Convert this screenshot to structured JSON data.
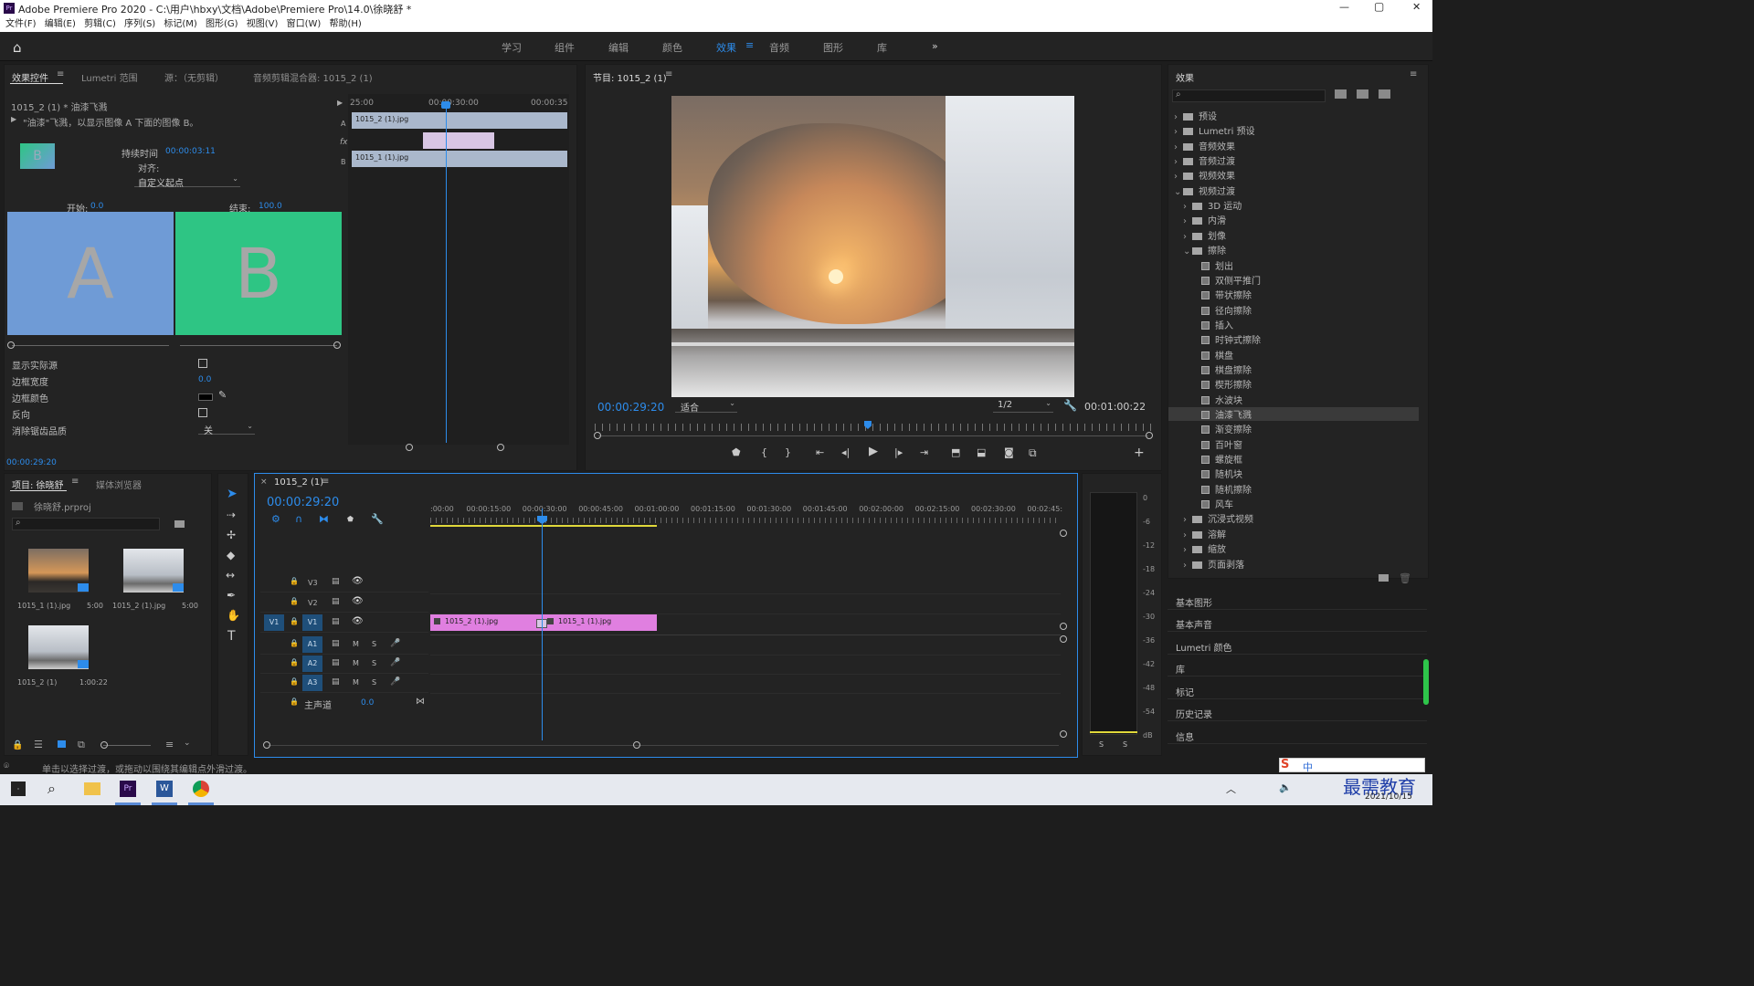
{
  "app": {
    "title": "Adobe Premiere Pro 2020 - C:\\用户\\hbxy\\文档\\Adobe\\Premiere Pro\\14.0\\徐晓舒 *",
    "win_min": "—",
    "win_max": "▢",
    "win_close": "✕"
  },
  "menu": [
    "文件(F)",
    "编辑(E)",
    "剪辑(C)",
    "序列(S)",
    "标记(M)",
    "图形(G)",
    "视图(V)",
    "窗口(W)",
    "帮助(H)"
  ],
  "workspaces": [
    "学习",
    "组件",
    "编辑",
    "颜色",
    "效果",
    "音频",
    "图形",
    "库"
  ],
  "workspace_active": "效果",
  "workspace_more": "»",
  "effect_controls": {
    "tabs": [
      "效果控件",
      "Lumetri 范围",
      "源：（无剪辑）",
      "音频剪辑混合器: 1015_2 (1)"
    ],
    "clip_name": "1015_2 (1) * 油漆飞溅",
    "description": "\"油漆\"飞溅，以显示图像 A 下面的图像 B。",
    "duration_label": "持续时间",
    "duration_value": "00:00:03:11",
    "align_label": "对齐:",
    "align_value": "自定义起点",
    "start_label": "开始:",
    "start_value": "0.0",
    "end_label": "结束:",
    "end_value": "100.0",
    "preview_a": "A",
    "preview_b": "B",
    "thumb_letter": "B",
    "timecodes": [
      "25:00",
      "00:00:30:00",
      "00:00:35"
    ],
    "clip_a": "1015_2 (1).jpg",
    "clip_b": "1015_1 (1).jpg",
    "track_a": "A",
    "track_b": "B",
    "fx": "fx",
    "props": [
      {
        "label": "显示实际源",
        "value": ""
      },
      {
        "label": "边框宽度",
        "value": "0.0"
      },
      {
        "label": "边框颜色",
        "value": ""
      },
      {
        "label": "反向",
        "value": ""
      },
      {
        "label": "消除锯齿品质",
        "value": "关"
      }
    ],
    "current_time": "00:00:29:20"
  },
  "program": {
    "title": "节目: 1015_2 (1)",
    "timecode": "00:00:29:20",
    "fit": "适合",
    "resolution": "1/2",
    "duration": "00:01:00:22",
    "playhead_fraction": 0.49
  },
  "effects_panel": {
    "title": "效果",
    "tree": [
      {
        "label": "预设",
        "level": 0,
        "type": "folder",
        "open": false
      },
      {
        "label": "Lumetri 预设",
        "level": 0,
        "type": "folder",
        "open": false
      },
      {
        "label": "音频效果",
        "level": 0,
        "type": "folder",
        "open": false
      },
      {
        "label": "音频过渡",
        "level": 0,
        "type": "folder",
        "open": false
      },
      {
        "label": "视频效果",
        "level": 0,
        "type": "folder",
        "open": false
      },
      {
        "label": "视频过渡",
        "level": 0,
        "type": "folder",
        "open": true
      },
      {
        "label": "3D 运动",
        "level": 1,
        "type": "folder",
        "open": false
      },
      {
        "label": "内滑",
        "level": 1,
        "type": "folder",
        "open": false
      },
      {
        "label": "划像",
        "level": 1,
        "type": "folder",
        "open": false
      },
      {
        "label": "擦除",
        "level": 1,
        "type": "folder",
        "open": true
      },
      {
        "label": "划出",
        "level": 2,
        "type": "effect"
      },
      {
        "label": "双侧平推门",
        "level": 2,
        "type": "effect"
      },
      {
        "label": "带状擦除",
        "level": 2,
        "type": "effect"
      },
      {
        "label": "径向擦除",
        "level": 2,
        "type": "effect"
      },
      {
        "label": "插入",
        "level": 2,
        "type": "effect"
      },
      {
        "label": "时钟式擦除",
        "level": 2,
        "type": "effect"
      },
      {
        "label": "棋盘",
        "level": 2,
        "type": "effect"
      },
      {
        "label": "棋盘擦除",
        "level": 2,
        "type": "effect"
      },
      {
        "label": "楔形擦除",
        "level": 2,
        "type": "effect"
      },
      {
        "label": "水波块",
        "level": 2,
        "type": "effect"
      },
      {
        "label": "油漆飞溅",
        "level": 2,
        "type": "effect",
        "selected": true
      },
      {
        "label": "渐变擦除",
        "level": 2,
        "type": "effect"
      },
      {
        "label": "百叶窗",
        "level": 2,
        "type": "effect"
      },
      {
        "label": "螺旋框",
        "level": 2,
        "type": "effect"
      },
      {
        "label": "随机块",
        "level": 2,
        "type": "effect"
      },
      {
        "label": "随机擦除",
        "level": 2,
        "type": "effect"
      },
      {
        "label": "风车",
        "level": 2,
        "type": "effect"
      },
      {
        "label": "沉浸式视频",
        "level": 1,
        "type": "folder",
        "open": false
      },
      {
        "label": "溶解",
        "level": 1,
        "type": "folder",
        "open": false
      },
      {
        "label": "缩放",
        "level": 1,
        "type": "folder",
        "open": false
      },
      {
        "label": "页面剥落",
        "level": 1,
        "type": "folder",
        "open": false
      }
    ],
    "sections": [
      "基本图形",
      "基本声音",
      "Lumetri 颜色",
      "库",
      "标记",
      "历史记录",
      "信息"
    ]
  },
  "project": {
    "tabs": [
      "项目: 徐晓舒",
      "媒体浏览器"
    ],
    "file": "徐晓舒.prproj",
    "items": [
      {
        "name": "1015_1 (1).jpg",
        "duration": "5:00"
      },
      {
        "name": "1015_2 (1).jpg",
        "duration": "5:00"
      },
      {
        "name": "1015_2 (1)",
        "duration": "1:00:22"
      }
    ]
  },
  "timeline": {
    "tab": "1015_2 (1)",
    "timecode": "00:00:29:20",
    "ruler": [
      ":00:00",
      "00:00:15:00",
      "00:00:30:00",
      "00:00:45:00",
      "00:01:00:00",
      "00:01:15:00",
      "00:01:30:00",
      "00:01:45:00",
      "00:02:00:00",
      "00:02:15:00",
      "00:02:30:00",
      "00:02:45:"
    ],
    "video_tracks": [
      "V3",
      "V2",
      "V1"
    ],
    "audio_tracks": [
      "A1",
      "A2",
      "A3"
    ],
    "source_patch": "V1",
    "master_label": "主声道",
    "master_value": "0.0",
    "clips": [
      {
        "name": "1015_2 (1).jpg",
        "track": "V1"
      },
      {
        "name": "1015_1 (1).jpg",
        "track": "V1"
      }
    ],
    "mute": "M",
    "solo": "S"
  },
  "meter": {
    "scale": [
      "0",
      "-6",
      "-12",
      "-18",
      "-24",
      "-30",
      "-36",
      "-42",
      "-48",
      "-54",
      "dB"
    ],
    "solo_buttons": [
      "S",
      "S"
    ]
  },
  "status_bar": "单击以选择过渡，或拖动以围绕其编辑点外滑过渡。",
  "taskbar": {
    "date": "2021/10/15",
    "tray_text": "中",
    "watermark": "最需教育"
  },
  "colors": {
    "accent": "#2d8ceb",
    "preview_a": "#6f9bd6",
    "preview_b": "#2ec584",
    "clip_pink": "#e07fe0",
    "clip_blue": "#aab8cc"
  }
}
